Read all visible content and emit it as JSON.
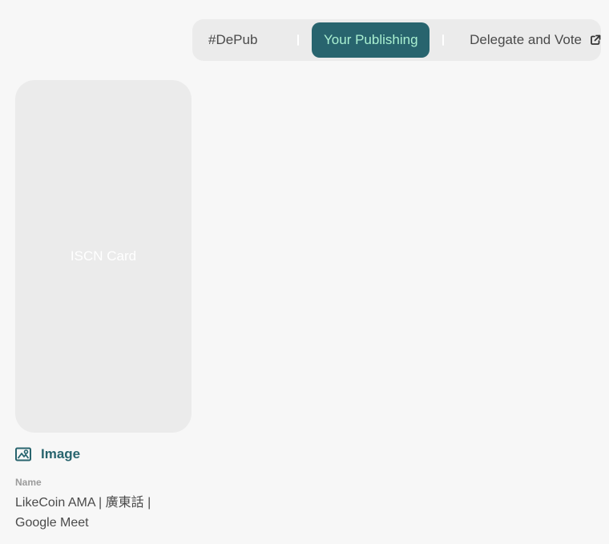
{
  "nav": {
    "items": [
      {
        "label": "#DePub",
        "active": false
      },
      {
        "label": "Your Publishing",
        "active": true
      },
      {
        "label": "Delegate and Vote",
        "active": false,
        "icon": "external-link-icon"
      }
    ]
  },
  "card": {
    "placeholder": "ISCN Card"
  },
  "record": {
    "type_icon": "image-icon",
    "type_label": "Image",
    "name_label": "Name",
    "name_value": "LikeCoin AMA | 廣東話 | Google Meet"
  },
  "colors": {
    "accent": "#28646e",
    "accent_text": "#aaf0d1",
    "background": "#f7f7f7",
    "surface": "#ebebeb",
    "text": "#4a4a4a",
    "muted": "#9b9b9b"
  }
}
